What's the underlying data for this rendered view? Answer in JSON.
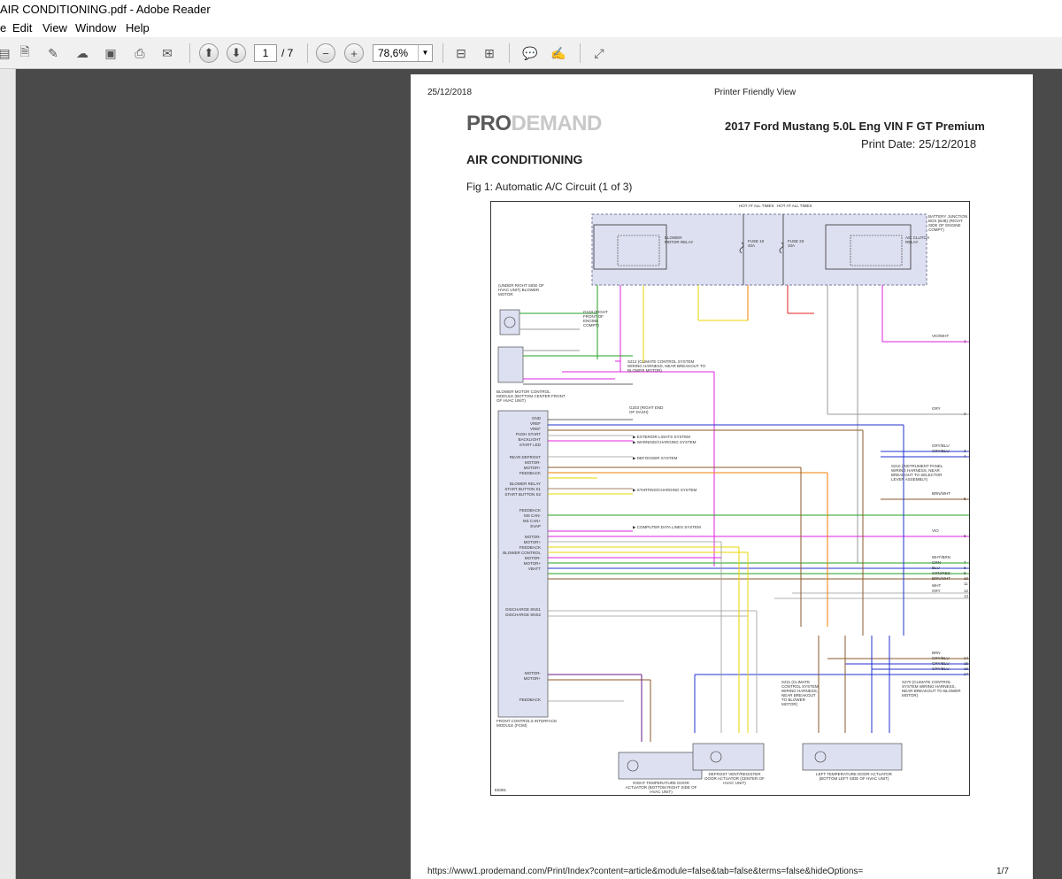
{
  "window": {
    "title": "AIR CONDITIONING.pdf - Adobe Reader"
  },
  "menu": [
    "Edit",
    "View",
    "Window",
    "Help"
  ],
  "toolbar": {
    "current_page": "1",
    "total_pages": "/ 7",
    "zoom": "78,6%"
  },
  "page": {
    "date": "25/12/2018",
    "header_center": "Printer Friendly View",
    "logo_a": "PRO",
    "logo_b": "DEMAND",
    "vehicle": "2017 Ford Mustang 5.0L Eng VIN F GT Premium",
    "print_date": "Print Date: 25/12/2018",
    "section": "AIR CONDITIONING",
    "figure": "Fig 1: Automatic A/C Circuit (1 of 3)",
    "footer_url": "https://www1.prodemand.com/Print/Index?content=article&module=false&tab=false&terms=false&hideOptions=",
    "footer_page": "1/7"
  },
  "diagram": {
    "top_labels": [
      "HOT AT ALL TIMES",
      "HOT AT ALL TIMES"
    ],
    "bjb_label": "BATTERY JUNCTION BOX (BJB) (RIGHT SIDE OF ENGINE COMPT)",
    "relay1": "BLOWER MOTOR RELAY",
    "relay2": "A/C CLUTCH RELAY",
    "fuse1": "FUSE 10 40A",
    "fuse2": "FUSE 23 10A",
    "blower_motor": "(UNDER RIGHT SIDE OF HVAC UNIT) BLOWER MOTOR",
    "blower_module": "BLOWER MOTOR CONTROL MODULE (BOTTOM CENTER FRONT OF HVAC UNIT)",
    "fcim": "FRONT CONTROLS INTERFACE MODULE (FCIM)",
    "s212": "S212 (CLIMATE CONTROL SYSTEM WIRING HARNESS, NEAR BREAKOUT TO BLOWER MOTOR)",
    "g103": "G103 (RIGHT FRONT OF ENGINE COMPT)",
    "g203": "G203 (RIGHT END OF DASH)",
    "s211": "S211 (CLIMATE CONTROL SYSTEM WIRING HARNESS, NEAR BREAKOUT TO BLOWER MOTOR)",
    "s210": "S210 (INSTRUMENT PANEL WIRING HARNESS, NEAR BREAKOUT TO SELECTOR LEVER ASSEMBLY)",
    "s270": "S270 (CLIMATE CONTROL SYSTEM WIRING HARNESS, NEAR BREAKOUT TO BLOWER MOTOR)",
    "act1": "RIGHT TEMPERATURE DOOR ACTUATOR (BOTTOM RIGHT SIDE OF HVAC UNIT)",
    "act2": "DEFROST VENT/REGISTER DOOR ACTUATOR (CENTER OF HVAC UNIT)",
    "act3": "LEFT TEMPERATURE DOOR ACTUATOR (BOTTOM LEFT SIDE OF HVAC UNIT)",
    "pins": [
      "GND",
      "VREF",
      "VREF",
      "PUSH START",
      "BACKLIGHT",
      "START LED",
      "REAR DEFROST",
      "MOTOR-",
      "MOTOR+",
      "FEEDBACK",
      "BLOWER RELAY",
      "START BUTTON S1",
      "START BUTTON S2",
      "FEEDBACK",
      "MS CAN-",
      "MS CAN+",
      "EVAP",
      "MOTOR-",
      "MOTOR+",
      "FEEDBACK",
      "BLOWER CONTROL",
      "MOTOR-",
      "MOTOR+",
      "VBATT",
      "DISCHARGE SNS1",
      "DISCHARGE SNS2",
      "MOTOR-",
      "MOTOR+",
      "FEEDBACK"
    ],
    "right_wires": [
      "VIO/WHT",
      "GRY",
      "GRY/BLU",
      "GRY/BLU",
      "BRN/WHT",
      "VIO",
      "WHT/BRN",
      "GRN",
      "BLU",
      "GRN/RED",
      "BRN/WHT",
      "WHT",
      "GRY",
      "BRN",
      "GRY/BLU",
      "GRY/BLU",
      "GRY/BLU"
    ],
    "right_nums": [
      "1",
      "2",
      "3",
      "4",
      "5",
      "6",
      "7",
      "8",
      "9",
      "10",
      "11",
      "12",
      "13",
      "14",
      "15",
      "16",
      "17"
    ],
    "systems": [
      "EXTERIOR LIGHTS SYSTEM",
      "WARNING/CHARGING SYSTEM",
      "DEFOGGER SYSTEM",
      "STARTING/CHARGING SYSTEM",
      "COMPUTER DATA LINES SYSTEM"
    ],
    "fig_id": "E8391"
  },
  "colors": {
    "yellow": "#e8d400",
    "magenta": "#e020e0",
    "green": "#20a020",
    "blue": "#2030d0",
    "brown": "#8b5a2b",
    "red": "#e02020",
    "orange": "#f08000",
    "gray": "#999999",
    "cyan_box": "#dde0f0"
  }
}
